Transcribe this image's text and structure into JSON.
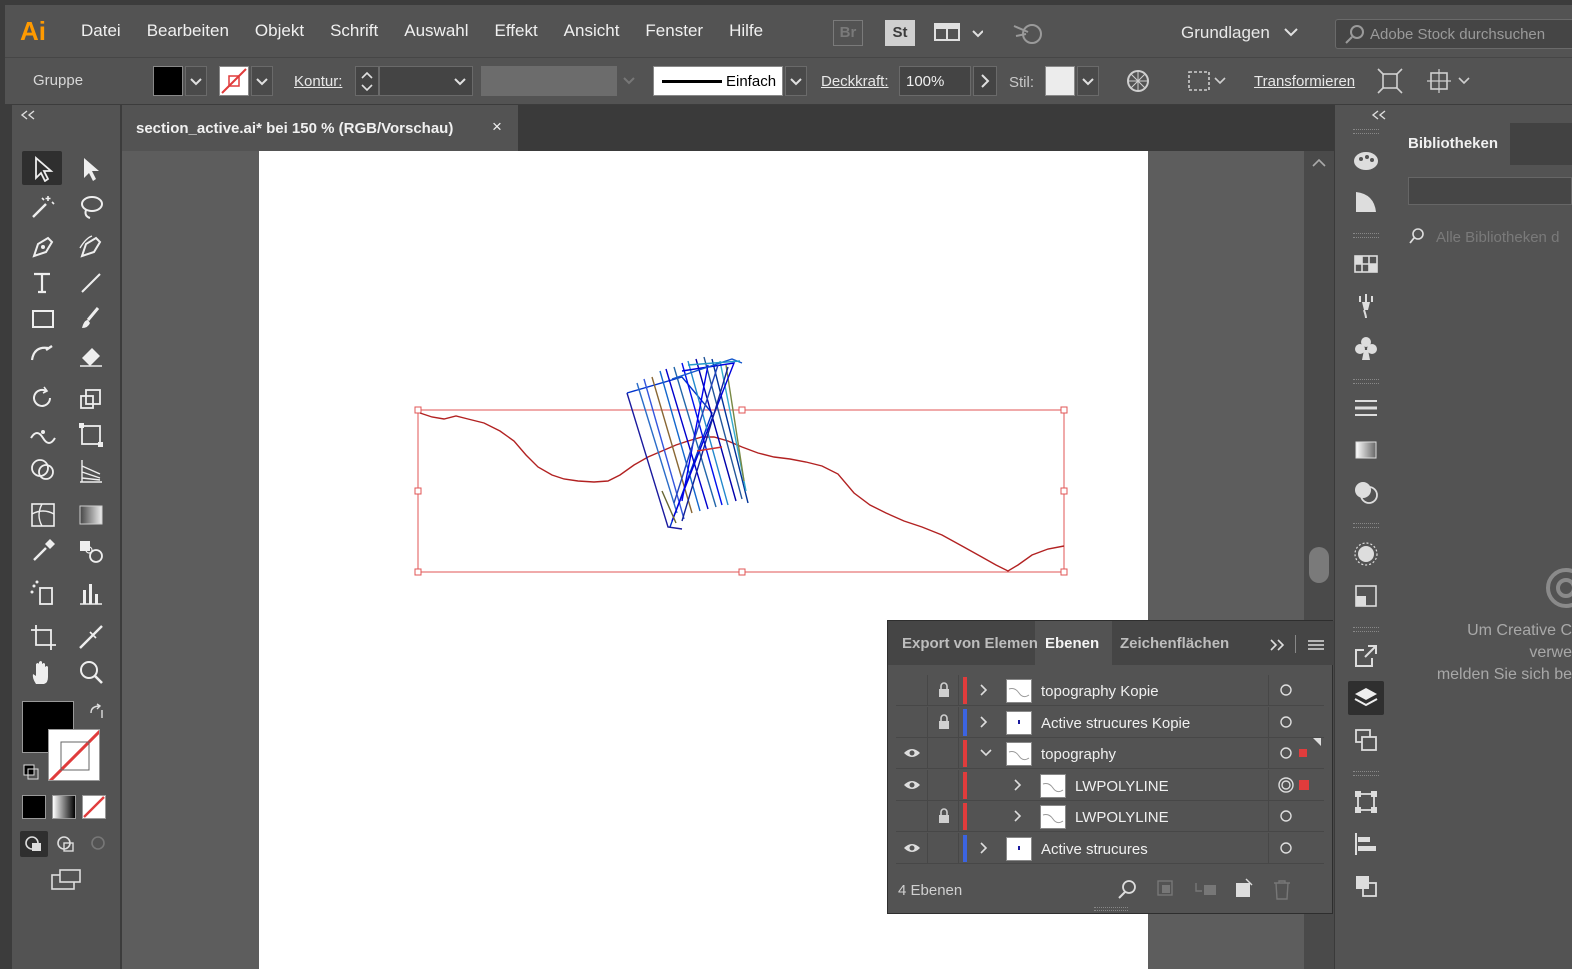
{
  "app": {
    "logo": "Ai",
    "workspace": "Grundlagen",
    "bridge_badge": "Br",
    "stock_badge": "St"
  },
  "menu": [
    "Datei",
    "Bearbeiten",
    "Objekt",
    "Schrift",
    "Auswahl",
    "Effekt",
    "Ansicht",
    "Fenster",
    "Hilfe"
  ],
  "search": {
    "placeholder": "Adobe Stock durchsuchen"
  },
  "control_bar": {
    "selection": "Gruppe",
    "kontur_label": "Kontur:",
    "stroke_profile": "Einfach",
    "opacity_label": "Deckkraft:",
    "opacity_value": "100%",
    "style_label": "Stil:",
    "transform_label": "Transformieren"
  },
  "document": {
    "tab_title": "section_active.ai* bei 150 % (RGB/Vorschau)",
    "close": "×"
  },
  "layers_panel": {
    "tabs": [
      "Export von Elemen",
      "Ebenen",
      "Zeichenflächen"
    ],
    "active_tab": "Ebenen",
    "rows": [
      {
        "name": "topography Kopie",
        "visible": false,
        "locked": true,
        "color": "#e03c3c",
        "expanded": false,
        "indent": 0
      },
      {
        "name": "Active strucures Kopie",
        "visible": false,
        "locked": true,
        "color": "#3c64e0",
        "expanded": false,
        "indent": 0
      },
      {
        "name": "topography",
        "visible": true,
        "locked": false,
        "color": "#e03c3c",
        "expanded": true,
        "indent": 0,
        "selected": true
      },
      {
        "name": "LWPOLYLINE",
        "visible": true,
        "locked": false,
        "color": "#e03c3c",
        "expanded": false,
        "indent": 1,
        "targeted": true
      },
      {
        "name": "LWPOLYLINE",
        "visible": false,
        "locked": true,
        "color": "#e03c3c",
        "expanded": false,
        "indent": 1
      },
      {
        "name": "Active strucures",
        "visible": true,
        "locked": false,
        "color": "#3c64e0",
        "expanded": false,
        "indent": 0
      }
    ],
    "count_label": "4 Ebenen"
  },
  "libraries_panel": {
    "title": "Bibliotheken",
    "search_placeholder": "Alle Bibliotheken d",
    "message_lines": [
      "Um Creative C",
      "verwe",
      "melden Sie sich be"
    ]
  },
  "colors": {
    "accent_orange": "#ff9a00",
    "selection_red": "#e03c3c",
    "layer_blue": "#3c64e0",
    "topo_line": "#b22222"
  }
}
